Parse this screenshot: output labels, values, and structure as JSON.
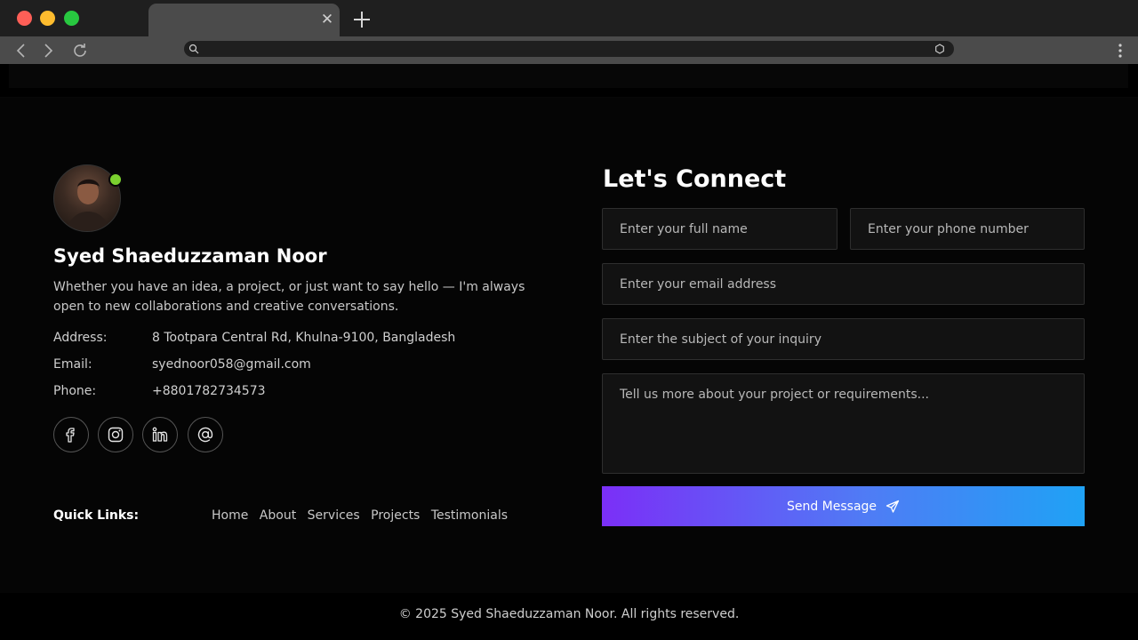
{
  "browser": {
    "tab_close": "✕"
  },
  "profile": {
    "name": "Syed Shaeduzzaman Noor",
    "bio": "Whether you have an idea, a project, or just want to say hello — I'm always open to new collaborations and creative conversations.",
    "online_color": "#7bd12f"
  },
  "contact_info": {
    "address_label": "Address:",
    "address_value": "8 Tootpara Central Rd, Khulna-9100, Bangladesh",
    "email_label": "Email:",
    "email_value": "syednoor058@gmail.com",
    "phone_label": "Phone:",
    "phone_value": "+8801782734573"
  },
  "socials": [
    "facebook-icon",
    "instagram-icon",
    "linkedin-icon",
    "at-icon"
  ],
  "quick_links": {
    "label": "Quick Links:",
    "items": [
      "Home",
      "About",
      "Services",
      "Projects",
      "Testimonials"
    ]
  },
  "form": {
    "title": "Let's Connect",
    "name_placeholder": "Enter your full name",
    "phone_placeholder": "Enter your phone number",
    "email_placeholder": "Enter your email address",
    "subject_placeholder": "Enter the subject of your inquiry",
    "message_placeholder": "Tell us more about your project or requirements...",
    "submit_label": "Send Message"
  },
  "colors": {
    "accent_start": "#7b2ff7",
    "accent_end": "#1fa2f5"
  },
  "footer": {
    "copyright": "© 2025 Syed Shaeduzzaman Noor.  All rights reserved."
  }
}
